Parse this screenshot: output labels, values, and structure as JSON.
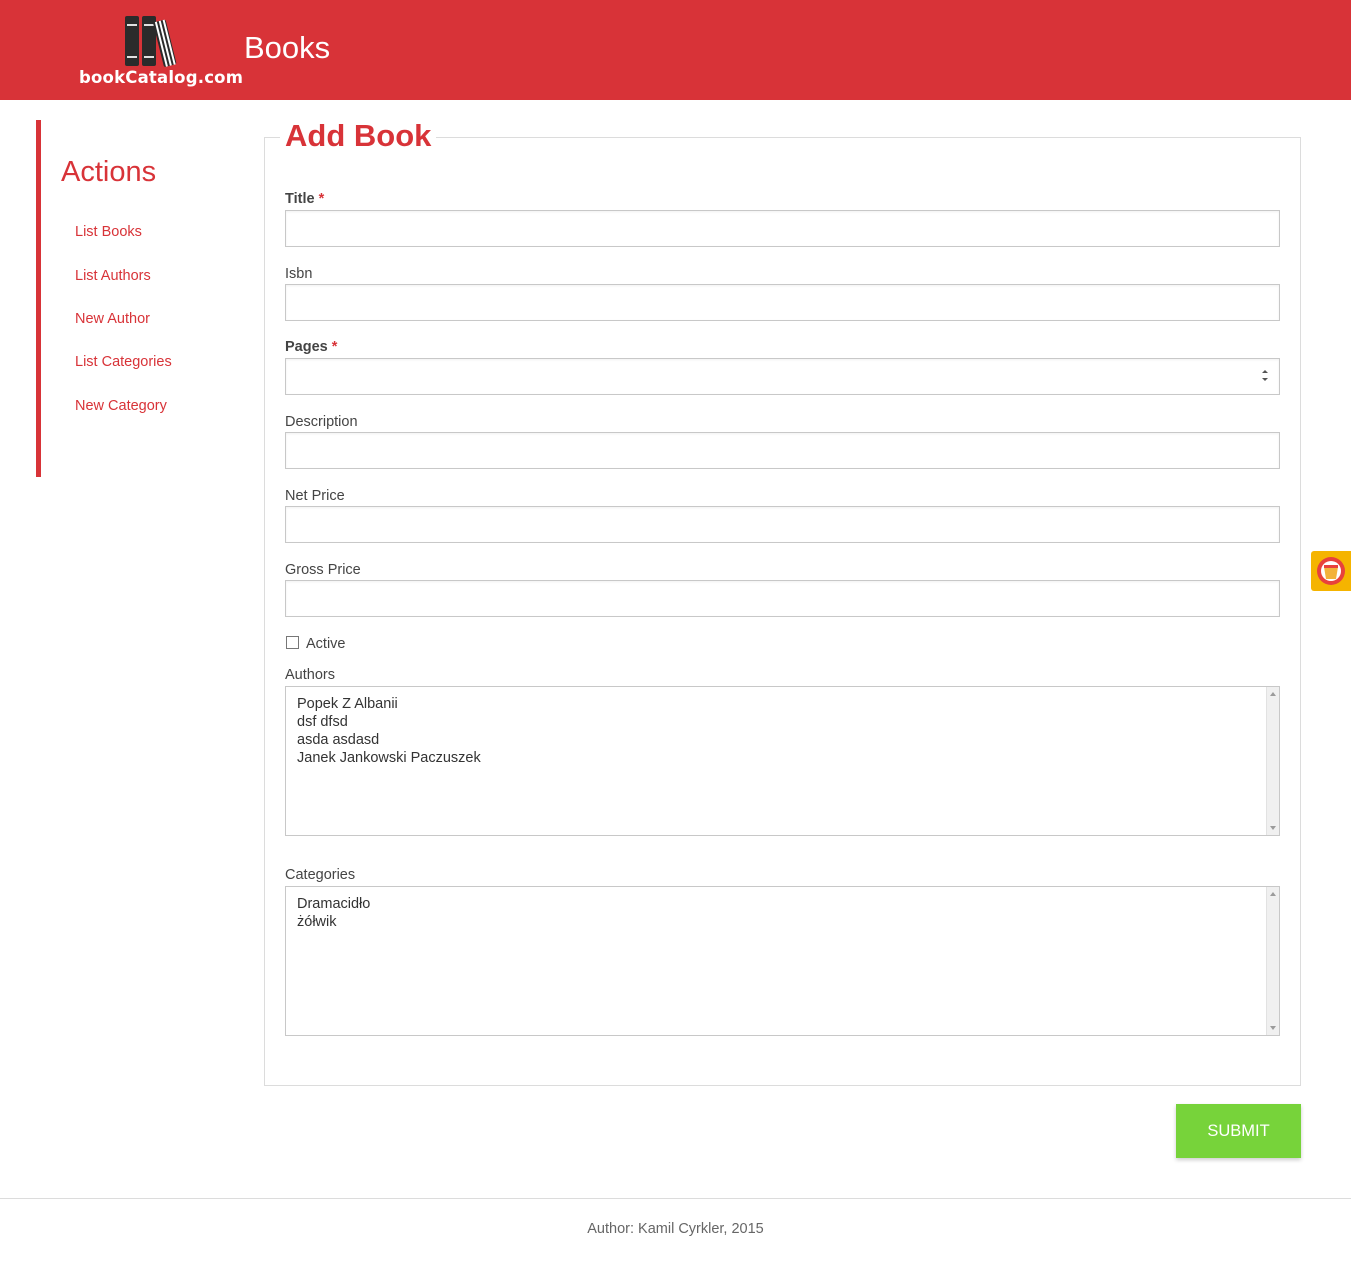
{
  "header": {
    "logo_text": "bookCatalog.com",
    "title": "Books"
  },
  "sidebar": {
    "title": "Actions",
    "items": [
      {
        "label": "List Books"
      },
      {
        "label": "List Authors"
      },
      {
        "label": "New Author"
      },
      {
        "label": "List Categories"
      },
      {
        "label": "New Category"
      }
    ]
  },
  "form": {
    "legend": "Add Book",
    "required_mark": "*",
    "fields": {
      "title": {
        "label": "Title",
        "value": ""
      },
      "isbn": {
        "label": "Isbn",
        "value": ""
      },
      "pages": {
        "label": "Pages",
        "value": ""
      },
      "description": {
        "label": "Description",
        "value": ""
      },
      "net_price": {
        "label": "Net Price",
        "value": ""
      },
      "gross_price": {
        "label": "Gross Price",
        "value": ""
      }
    },
    "active": {
      "label": "Active",
      "checked": false
    },
    "authors": {
      "label": "Authors",
      "options": [
        "Popek Z Albanii",
        "dsf dfsd",
        "asda asdasd",
        "Janek Jankowski Paczuszek"
      ]
    },
    "categories": {
      "label": "Categories",
      "options": [
        "Dramacidło",
        "żółwik"
      ]
    },
    "submit_label": "SUBMIT"
  },
  "footer": {
    "text": "Author: Kamil Cyrkler, 2015"
  },
  "colors": {
    "brand_red": "#d83338",
    "submit_green": "#77d33a",
    "badge_yellow": "#f5b400"
  },
  "icons": {
    "logo": "books-logo-icon",
    "side_badge": "extension-badge-icon"
  }
}
